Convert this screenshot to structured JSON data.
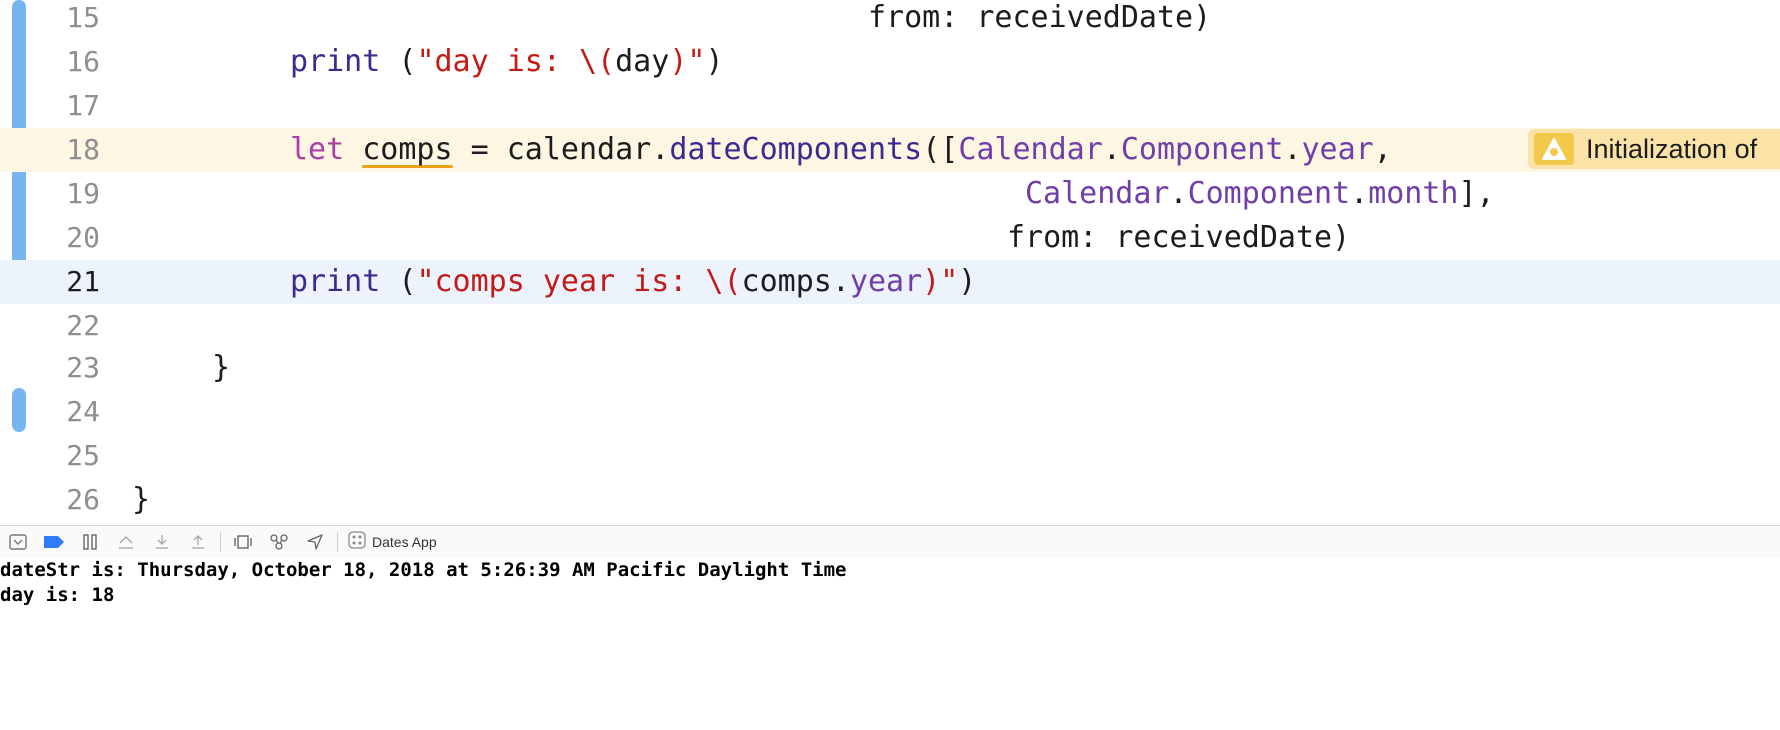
{
  "editor": {
    "line_numbers": [
      "15",
      "16",
      "17",
      "18",
      "19",
      "20",
      "21",
      "22",
      "23",
      "24",
      "25",
      "26"
    ],
    "line15": {
      "text": "from: receivedDate)"
    },
    "line16": {
      "fn": "print",
      "open": " (",
      "str_a": "\"day is: \\(",
      "expr": "day",
      "str_b": ")\"",
      "close": ")"
    },
    "line18": {
      "kw": "let",
      "var": "comps",
      "eq": " = ",
      "obj": "calendar",
      "dot": ".",
      "method": "dateComponents",
      "open": "([",
      "type": "Calendar",
      "dot2": ".",
      "sub": "Component",
      "dot3": ".",
      "member": "year",
      "comma": ","
    },
    "line19": {
      "type": "Calendar",
      "dot": ".",
      "sub": "Component",
      "dot2": ".",
      "member": "month",
      "close": "],"
    },
    "line20": {
      "text": "from: receivedDate)"
    },
    "line21": {
      "fn": "print",
      "open": " (",
      "str_a": "\"comps year is: \\(",
      "expr": "comps",
      "dot": ".",
      "member": "year",
      "str_b": ")\"",
      "close": ")"
    },
    "line23": {
      "text": "}"
    },
    "line26": {
      "text": "}"
    },
    "warning": {
      "icon": "warning-triangle-icon",
      "text": "Initialization of"
    },
    "colors": {
      "keyword": "#ad3da4",
      "string": "#c41a16",
      "type": "#703daa",
      "change_bar": "#78b4f0"
    }
  },
  "debug_bar": {
    "scheme_label": "Dates App",
    "icons": [
      "hide-debug-area-icon",
      "breakpoints-toggle-icon",
      "pause-icon",
      "step-over-icon",
      "step-into-icon",
      "step-out-icon",
      "view-debugger-icon",
      "memory-graph-icon",
      "simulate-location-icon",
      "scheme-icon"
    ]
  },
  "console": {
    "lines": [
      "dateStr is: Thursday, October 18, 2018 at 5:26:39 AM Pacific Daylight Time",
      "day is: 18"
    ]
  }
}
